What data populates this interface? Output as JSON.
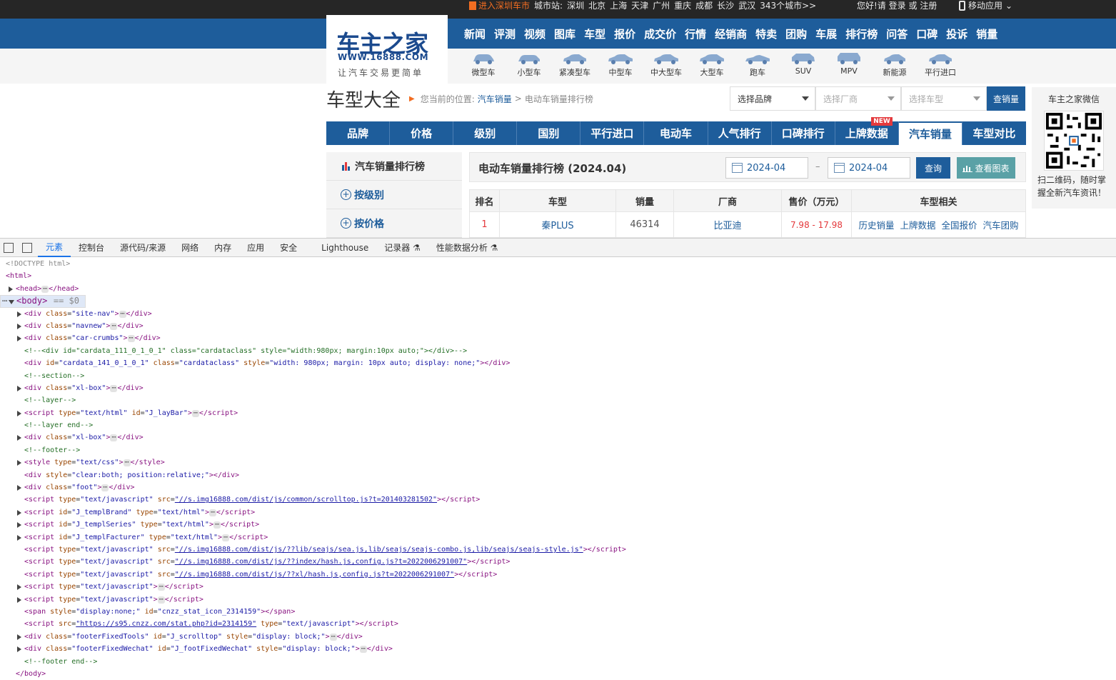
{
  "topbar": {
    "enter_city": "进入深圳车市",
    "city_label": "城市站:",
    "cities": [
      "深圳",
      "北京",
      "上海",
      "天津",
      "广州",
      "重庆",
      "成都",
      "长沙",
      "武汉"
    ],
    "more_cities": "343个城市>>",
    "greeting": "您好!请",
    "login": "登录",
    "or": "或",
    "register": "注册",
    "mobile": "移动应用"
  },
  "logo": {
    "brand": "车主之家",
    "url": "WWW.16888.COM",
    "slogan": "让汽车交易更简单"
  },
  "mainnav": [
    "新闻",
    "评测",
    "视频",
    "图库",
    "车型",
    "报价",
    "成交价",
    "行情",
    "经销商",
    "特卖",
    "团购",
    "车展",
    "排行榜",
    "问答",
    "口碑",
    "投诉",
    "销量"
  ],
  "cartypes": [
    "微型车",
    "小型车",
    "紧凑型车",
    "中型车",
    "中大型车",
    "大型车",
    "跑车",
    "SUV",
    "MPV",
    "新能源",
    "平行进口"
  ],
  "crumb": {
    "title": "车型大全",
    "loc_label": "您当前的位置:",
    "link": "汽车销量",
    "sep": ">",
    "current": "电动车销量排行榜"
  },
  "selects": {
    "brand": "选择品牌",
    "maker": "选择厂商",
    "model": "选择车型",
    "button": "查销量"
  },
  "tabs": [
    "品牌",
    "价格",
    "级别",
    "国别",
    "平行进口",
    "电动车",
    "人气排行",
    "口碑排行",
    "上牌数据",
    "汽车销量",
    "车型对比"
  ],
  "new_badge": "NEW",
  "side": {
    "title": "汽车销量排行榜",
    "items": [
      "按级别",
      "按价格"
    ]
  },
  "panel": {
    "title": "电动车销量排行榜 (2024.04)",
    "date_from": "2024-04",
    "date_to": "2024-04",
    "dash": "–",
    "query": "查询",
    "chart": "查看图表"
  },
  "table": {
    "headers": [
      "排名",
      "车型",
      "销量",
      "厂商",
      "售价（万元）",
      "车型相关"
    ],
    "rows": [
      {
        "rank": "1",
        "model": "秦PLUS",
        "sales": "46314",
        "maker": "比亚迪",
        "price": "7.98 - 17.98",
        "links": [
          "历史销量",
          "上牌数据",
          "全国报价",
          "汽车团购"
        ]
      }
    ]
  },
  "wechat": {
    "title": "车主之家微信",
    "desc": "扫二维码，随时掌握全新汽车资讯！"
  },
  "devtools": {
    "tabs": [
      "元素",
      "控制台",
      "源代码/来源",
      "网络",
      "内存",
      "应用",
      "安全",
      "Lighthouse",
      "记录器 ⚗",
      "性能数据分析 ⚗"
    ]
  },
  "colors": {
    "brand_blue": "#1e5d9b",
    "orange": "#f26d21",
    "price_red": "#e4393c"
  }
}
